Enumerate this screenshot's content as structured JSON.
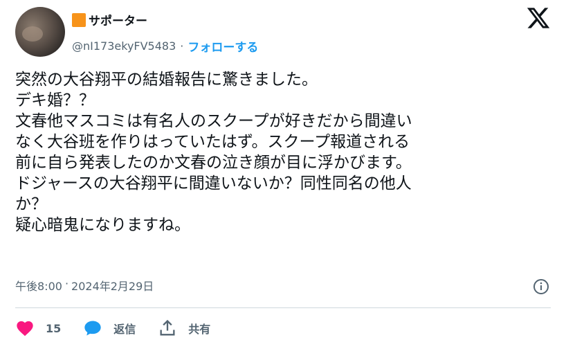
{
  "author": {
    "display_name": "サポーター",
    "handle": "@nI173ekyFV5483",
    "separator": "·",
    "follow_label": "フォローする"
  },
  "tweet": {
    "text": "突然の大谷翔平の結婚報告に驚きました。\nデキ婚？？\n文春他マスコミは有名人のスクープが好きだから間違い\nなく大谷班を作りはっていたはず。スクープ報道される\n前に自ら発表したのか文春の泣き顔が目に浮かびます。\nドジャースの大谷翔平に間違いないか？同性同名の他人\nか？\n疑心暗鬼になりますね。"
  },
  "meta": {
    "time": "午後8:00",
    "separator": "·",
    "date": "2024年2月29日"
  },
  "actions": {
    "like_count": "15",
    "reply_label": "返信",
    "share_label": "共有"
  },
  "icons": {
    "logo": "x-logo-icon",
    "info": "info-icon",
    "like": "heart-icon",
    "reply": "speech-bubble-icon",
    "share": "share-icon"
  },
  "colors": {
    "accent": "#1d9bf0",
    "like": "#f91880",
    "muted": "#536471",
    "badge": "#f7931a"
  }
}
